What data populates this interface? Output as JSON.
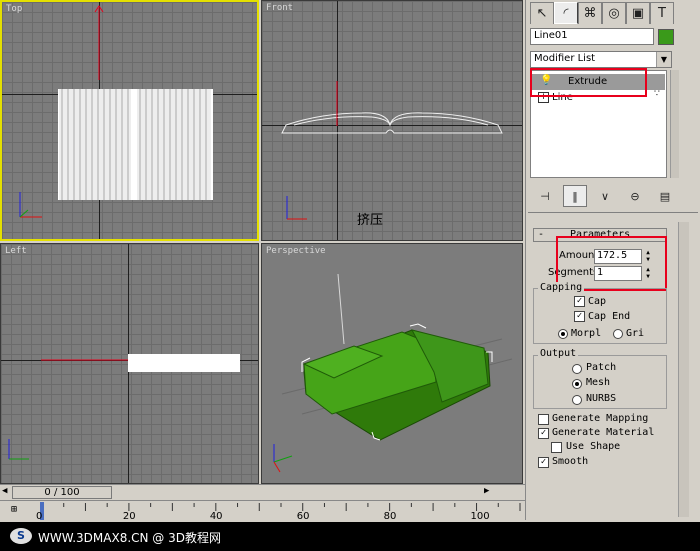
{
  "viewports": {
    "top": {
      "label": "Top"
    },
    "front": {
      "label": "Front",
      "annotation": "挤压"
    },
    "left": {
      "label": "Left"
    },
    "perspective": {
      "label": "Perspective"
    }
  },
  "panel": {
    "tabs": [
      {
        "icon": "pointer-icon",
        "glyph": "↖"
      },
      {
        "icon": "modify-icon",
        "glyph": "◜"
      },
      {
        "icon": "hierarchy-icon",
        "glyph": "⌘"
      },
      {
        "icon": "motion-icon",
        "glyph": "◎"
      },
      {
        "icon": "display-icon",
        "glyph": "▣"
      },
      {
        "icon": "utilities-icon",
        "glyph": "T"
      }
    ],
    "object_name": "Line01",
    "object_color": "#3a9a1a",
    "modifier_list": "Modifier List",
    "stack": [
      {
        "label": "Extrude"
      },
      {
        "label": "Line"
      }
    ],
    "rollout_title": "Parameters",
    "amount_label": "Amount:",
    "amount_value": "172.5",
    "segments_label": "Segments:",
    "segments_value": "1",
    "capping": {
      "title": "Capping",
      "cap_start": "Cap",
      "cap_end": "Cap End",
      "morph": "Morpl",
      "grid": "Gri"
    },
    "output": {
      "title": "Output",
      "patch": "Patch",
      "mesh": "Mesh",
      "nurbs": "NURBS"
    },
    "generate_mapping": "Generate Mapping",
    "generate_material": "Generate Material",
    "use_shape": "Use Shape",
    "smooth": "Smooth"
  },
  "timeline": {
    "frame": "0 / 100",
    "ticks": [
      "0",
      "20",
      "40",
      "60",
      "80",
      "100"
    ]
  },
  "footer": {
    "site": "WWW.3DMAX8.CN @ 3D教程网"
  },
  "colors": {
    "accent_red": "#e8001c",
    "active_viewport": "#e4e000",
    "book_green": "#3a8c10"
  }
}
